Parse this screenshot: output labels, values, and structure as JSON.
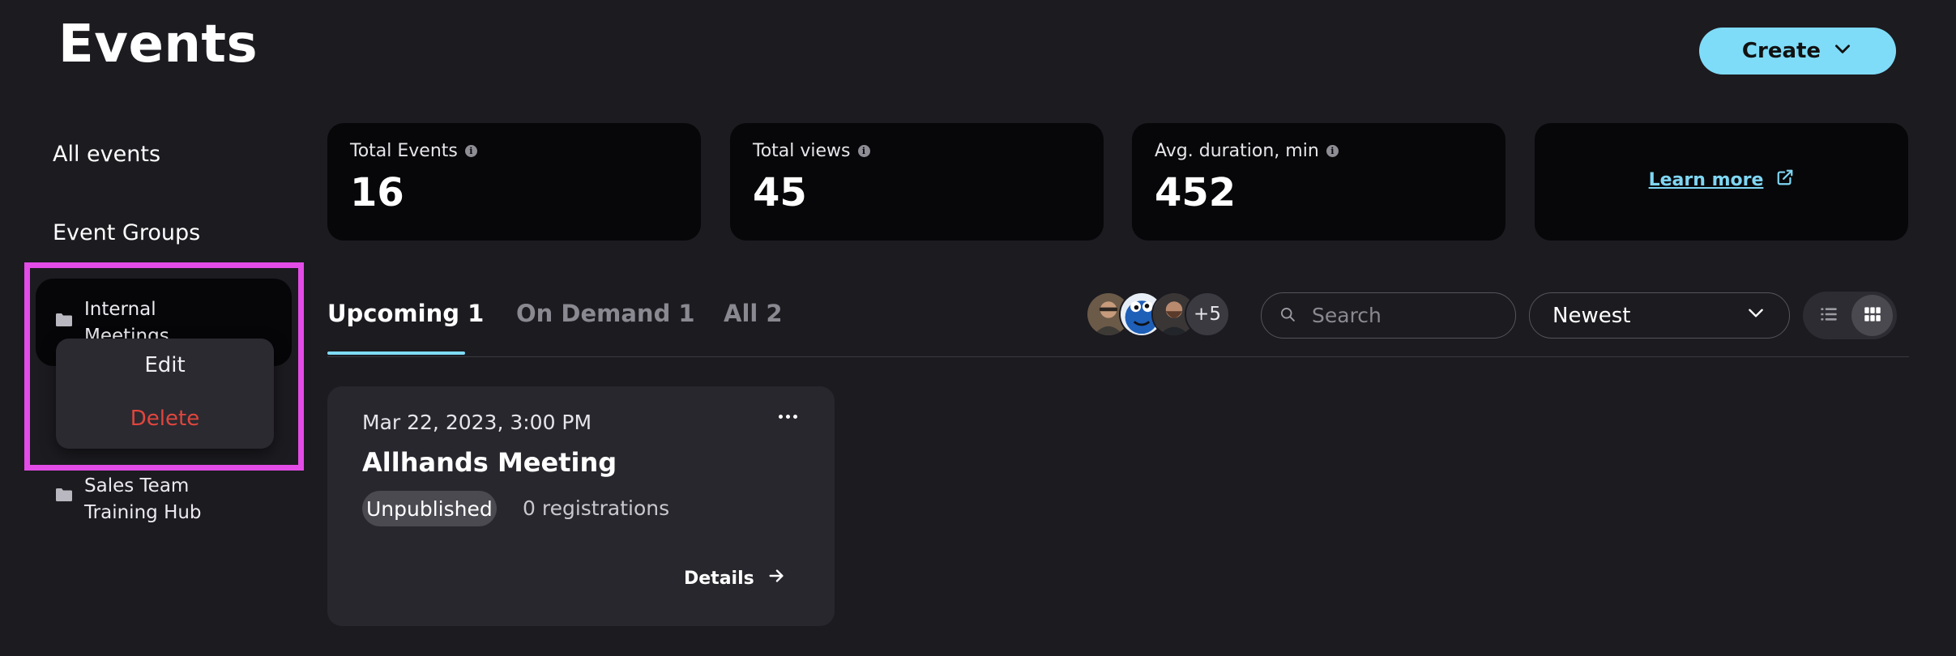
{
  "header": {
    "title": "Events",
    "create_label": "Create"
  },
  "sidebar": {
    "all_events": "All events",
    "event_groups": "Event Groups",
    "groups": [
      {
        "label": "Internal Meetings"
      },
      {
        "label": "Sales Team Training Hub"
      }
    ],
    "context_menu": {
      "edit": "Edit",
      "delete": "Delete"
    }
  },
  "stats": [
    {
      "label": "Total Events",
      "value": "16"
    },
    {
      "label": "Total views",
      "value": "45"
    },
    {
      "label": "Avg. duration, min",
      "value": "452"
    }
  ],
  "learn_more": "Learn more",
  "tabs": [
    {
      "label": "Upcoming 1",
      "active": true
    },
    {
      "label": "On Demand 1",
      "active": false
    },
    {
      "label": "All 2",
      "active": false
    }
  ],
  "avatars": {
    "extra_count": "+5"
  },
  "search": {
    "placeholder": "Search",
    "value": ""
  },
  "sort": {
    "selected": "Newest"
  },
  "event_card": {
    "date": "Mar 22, 2023, 3:00 PM",
    "title": "Allhands Meeting",
    "status": "Unpublished",
    "registrations": "0 registrations",
    "details_label": "Details"
  },
  "colors": {
    "accent": "#7fdcf8",
    "background": "#1c1b20",
    "card": "#070709",
    "danger": "#e0463d",
    "highlight": "#e34ce7"
  }
}
